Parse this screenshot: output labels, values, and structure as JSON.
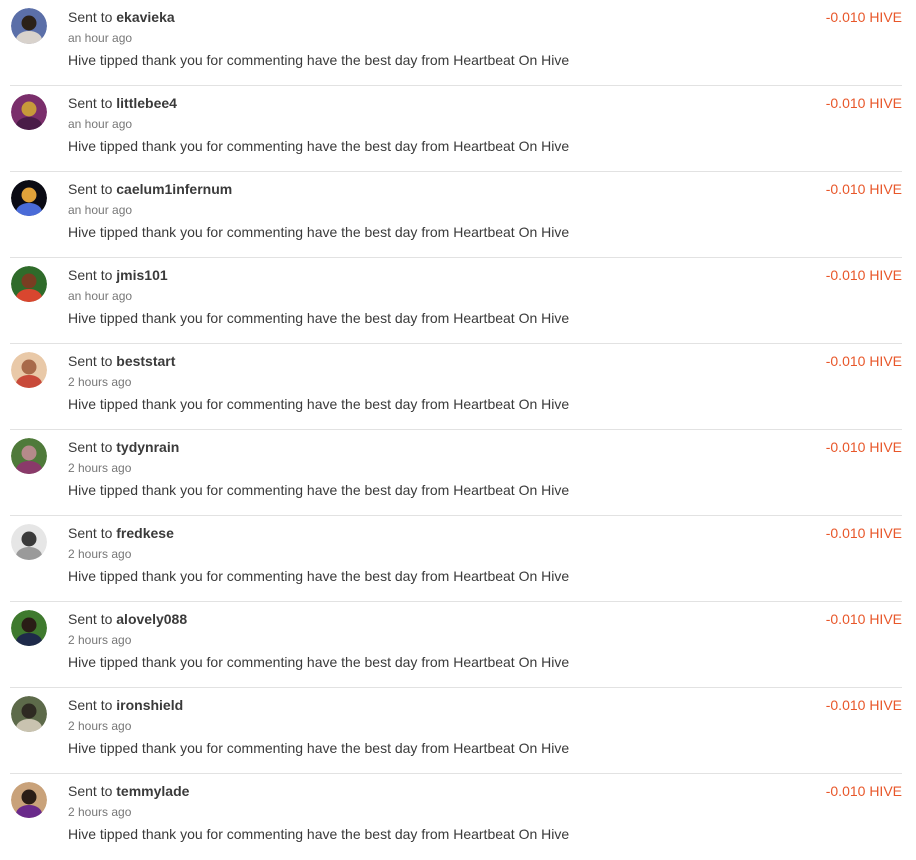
{
  "transactions": [
    {
      "prefix": "Sent to",
      "user": "ekavieka",
      "ago": "an hour ago",
      "memo": "Hive tipped thank you for commenting have the best day from Heartbeat On Hive",
      "amount": "-0.010 HIVE",
      "avatar": {
        "bg": "#5b6fa8",
        "fg": "#2b2118",
        "accent": "#d8d2cc"
      }
    },
    {
      "prefix": "Sent to",
      "user": "littlebee4",
      "ago": "an hour ago",
      "memo": "Hive tipped thank you for commenting have the best day from Heartbeat On Hive",
      "amount": "-0.010 HIVE",
      "avatar": {
        "bg": "#7a2e6b",
        "fg": "#c79a3a",
        "accent": "#4a1c48"
      }
    },
    {
      "prefix": "Sent to",
      "user": "caelum1infernum",
      "ago": "an hour ago",
      "memo": "Hive tipped thank you for commenting have the best day from Heartbeat On Hive",
      "amount": "-0.010 HIVE",
      "avatar": {
        "bg": "#0b0b14",
        "fg": "#e0a13a",
        "accent": "#4a6bd8"
      }
    },
    {
      "prefix": "Sent to",
      "user": "jmis101",
      "ago": "an hour ago",
      "memo": "Hive tipped thank you for commenting have the best day from Heartbeat On Hive",
      "amount": "-0.010 HIVE",
      "avatar": {
        "bg": "#2f6b2a",
        "fg": "#7a3d22",
        "accent": "#d9462f"
      }
    },
    {
      "prefix": "Sent to",
      "user": "beststart",
      "ago": "2 hours ago",
      "memo": "Hive tipped thank you for commenting have the best day from Heartbeat On Hive",
      "amount": "-0.010 HIVE",
      "avatar": {
        "bg": "#e9c9a8",
        "fg": "#a86a4a",
        "accent": "#c84a3a"
      }
    },
    {
      "prefix": "Sent to",
      "user": "tydynrain",
      "ago": "2 hours ago",
      "memo": "Hive tipped thank you for commenting have the best day from Heartbeat On Hive",
      "amount": "-0.010 HIVE",
      "avatar": {
        "bg": "#4f7a3a",
        "fg": "#b58a8a",
        "accent": "#8a3a6a"
      }
    },
    {
      "prefix": "Sent to",
      "user": "fredkese",
      "ago": "2 hours ago",
      "memo": "Hive tipped thank you for commenting have the best day from Heartbeat On Hive",
      "amount": "-0.010 HIVE",
      "avatar": {
        "bg": "#e6e6e6",
        "fg": "#3a3a3a",
        "accent": "#9a9a9a"
      }
    },
    {
      "prefix": "Sent to",
      "user": "alovely088",
      "ago": "2 hours ago",
      "memo": "Hive tipped thank you for commenting have the best day from Heartbeat On Hive",
      "amount": "-0.010 HIVE",
      "avatar": {
        "bg": "#3f7a2e",
        "fg": "#2a1d16",
        "accent": "#1e2a4a"
      }
    },
    {
      "prefix": "Sent to",
      "user": "ironshield",
      "ago": "2 hours ago",
      "memo": "Hive tipped thank you for commenting have the best day from Heartbeat On Hive",
      "amount": "-0.010 HIVE",
      "avatar": {
        "bg": "#5d6a4a",
        "fg": "#2e2a22",
        "accent": "#c9c3b0"
      }
    },
    {
      "prefix": "Sent to",
      "user": "temmylade",
      "ago": "2 hours ago",
      "memo": "Hive tipped thank you for commenting have the best day from Heartbeat On Hive",
      "amount": "-0.010 HIVE",
      "avatar": {
        "bg": "#c9a27a",
        "fg": "#2b1d16",
        "accent": "#6a2a8a"
      }
    }
  ]
}
